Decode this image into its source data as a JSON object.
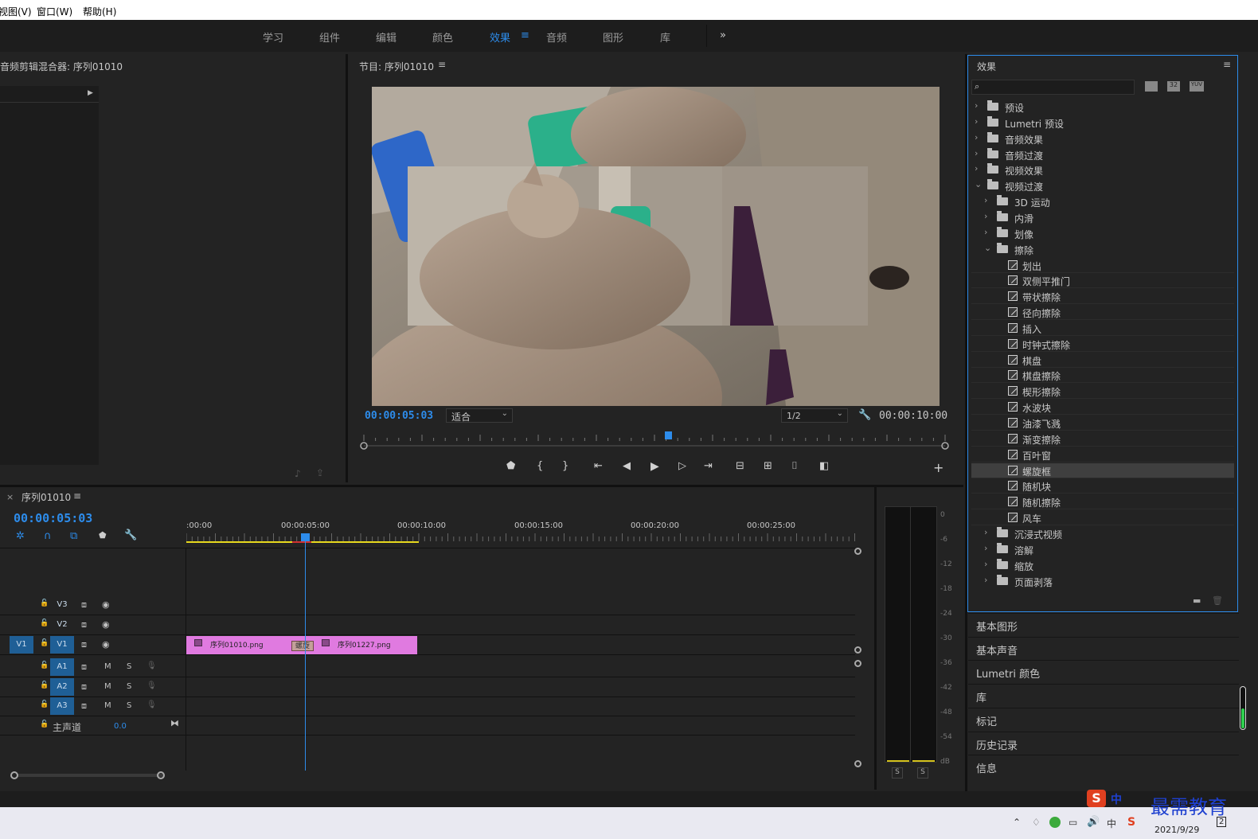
{
  "menu": [
    "视图(V)",
    "窗口(W)",
    "帮助(H)"
  ],
  "workspaces": [
    {
      "label": "学习"
    },
    {
      "label": "组件"
    },
    {
      "label": "编辑"
    },
    {
      "label": "颜色"
    },
    {
      "label": "效果",
      "active": true
    },
    {
      "label": "音频"
    },
    {
      "label": "图形"
    },
    {
      "label": "库"
    }
  ],
  "workspace_more": "»",
  "audio_mixer": {
    "title": "音频剪辑混合器: 序列01010"
  },
  "program": {
    "title": "节目: 序列01010",
    "timecode": "00:00:05:03",
    "fit": "适合",
    "resolution": "1/2",
    "duration": "00:00:10:00",
    "playhead_fraction": 0.5
  },
  "effects": {
    "title": "效果",
    "search_placeholder": "",
    "filter_badges": [
      "",
      "32",
      "YUV"
    ],
    "tree": [
      {
        "label": "预设",
        "level": 0,
        "type": "folder-special",
        "expanded": false
      },
      {
        "label": "Lumetri 预设",
        "level": 0,
        "type": "folder-special",
        "expanded": false
      },
      {
        "label": "音频效果",
        "level": 0,
        "type": "folder",
        "expanded": false
      },
      {
        "label": "音频过渡",
        "level": 0,
        "type": "folder",
        "expanded": false
      },
      {
        "label": "视频效果",
        "level": 0,
        "type": "folder",
        "expanded": false
      },
      {
        "label": "视频过渡",
        "level": 0,
        "type": "folder",
        "expanded": true
      },
      {
        "label": "3D 运动",
        "level": 1,
        "type": "folder",
        "expanded": false
      },
      {
        "label": "内滑",
        "level": 1,
        "type": "folder",
        "expanded": false
      },
      {
        "label": "划像",
        "level": 1,
        "type": "folder",
        "expanded": false
      },
      {
        "label": "擦除",
        "level": 1,
        "type": "folder",
        "expanded": true
      },
      {
        "label": "划出",
        "level": 2,
        "type": "effect"
      },
      {
        "label": "双侧平推门",
        "level": 2,
        "type": "effect"
      },
      {
        "label": "带状擦除",
        "level": 2,
        "type": "effect"
      },
      {
        "label": "径向擦除",
        "level": 2,
        "type": "effect"
      },
      {
        "label": "插入",
        "level": 2,
        "type": "effect"
      },
      {
        "label": "时钟式擦除",
        "level": 2,
        "type": "effect"
      },
      {
        "label": "棋盘",
        "level": 2,
        "type": "effect"
      },
      {
        "label": "棋盘擦除",
        "level": 2,
        "type": "effect"
      },
      {
        "label": "楔形擦除",
        "level": 2,
        "type": "effect"
      },
      {
        "label": "水波块",
        "level": 2,
        "type": "effect"
      },
      {
        "label": "油漆飞溅",
        "level": 2,
        "type": "effect"
      },
      {
        "label": "渐变擦除",
        "level": 2,
        "type": "effect"
      },
      {
        "label": "百叶窗",
        "level": 2,
        "type": "effect"
      },
      {
        "label": "螺旋框",
        "level": 2,
        "type": "effect",
        "selected": true
      },
      {
        "label": "随机块",
        "level": 2,
        "type": "effect"
      },
      {
        "label": "随机擦除",
        "level": 2,
        "type": "effect"
      },
      {
        "label": "风车",
        "level": 2,
        "type": "effect"
      },
      {
        "label": "沉浸式视频",
        "level": 1,
        "type": "folder",
        "expanded": false
      },
      {
        "label": "溶解",
        "level": 1,
        "type": "folder",
        "expanded": false
      },
      {
        "label": "缩放",
        "level": 1,
        "type": "folder",
        "expanded": false
      },
      {
        "label": "页面剥落",
        "level": 1,
        "type": "folder",
        "expanded": false
      }
    ]
  },
  "stacked_panels": [
    "基本图形",
    "基本声音",
    "Lumetri 颜色",
    "库",
    "标记",
    "历史记录",
    "信息"
  ],
  "timeline": {
    "title": "序列01010",
    "timecode": "00:00:05:03",
    "ruler": [
      ":00:00",
      "00:00:05:00",
      "00:00:10:00",
      "00:00:15:00",
      "00:00:20:00",
      "00:00:25:00"
    ],
    "video_tracks": [
      {
        "name": "V3"
      },
      {
        "name": "V2"
      },
      {
        "name": "V1",
        "source": "V1"
      }
    ],
    "audio_tracks": [
      {
        "name": "A1"
      },
      {
        "name": "A2"
      },
      {
        "name": "A3"
      }
    ],
    "track_labels": {
      "mute": "M",
      "solo": "S"
    },
    "master": {
      "label": "主声道",
      "value": "0.0"
    },
    "clips": [
      {
        "name": "序列01010.png"
      },
      {
        "name": "序列01227.png"
      }
    ],
    "transition": "螺旋"
  },
  "meter": {
    "scale": [
      "0",
      "-6",
      "-12",
      "-18",
      "-24",
      "-30",
      "-36",
      "-42",
      "-48",
      "-54",
      "dB"
    ],
    "solo": [
      "S",
      "S"
    ]
  },
  "taskbar": {
    "ime": "中",
    "date": "2021/9/29",
    "watermark": "最需教育",
    "notif": "2"
  },
  "colors": {
    "accent": "#2d8ceb",
    "clip": "#e07ae0",
    "track_active": "#1f5f96"
  }
}
